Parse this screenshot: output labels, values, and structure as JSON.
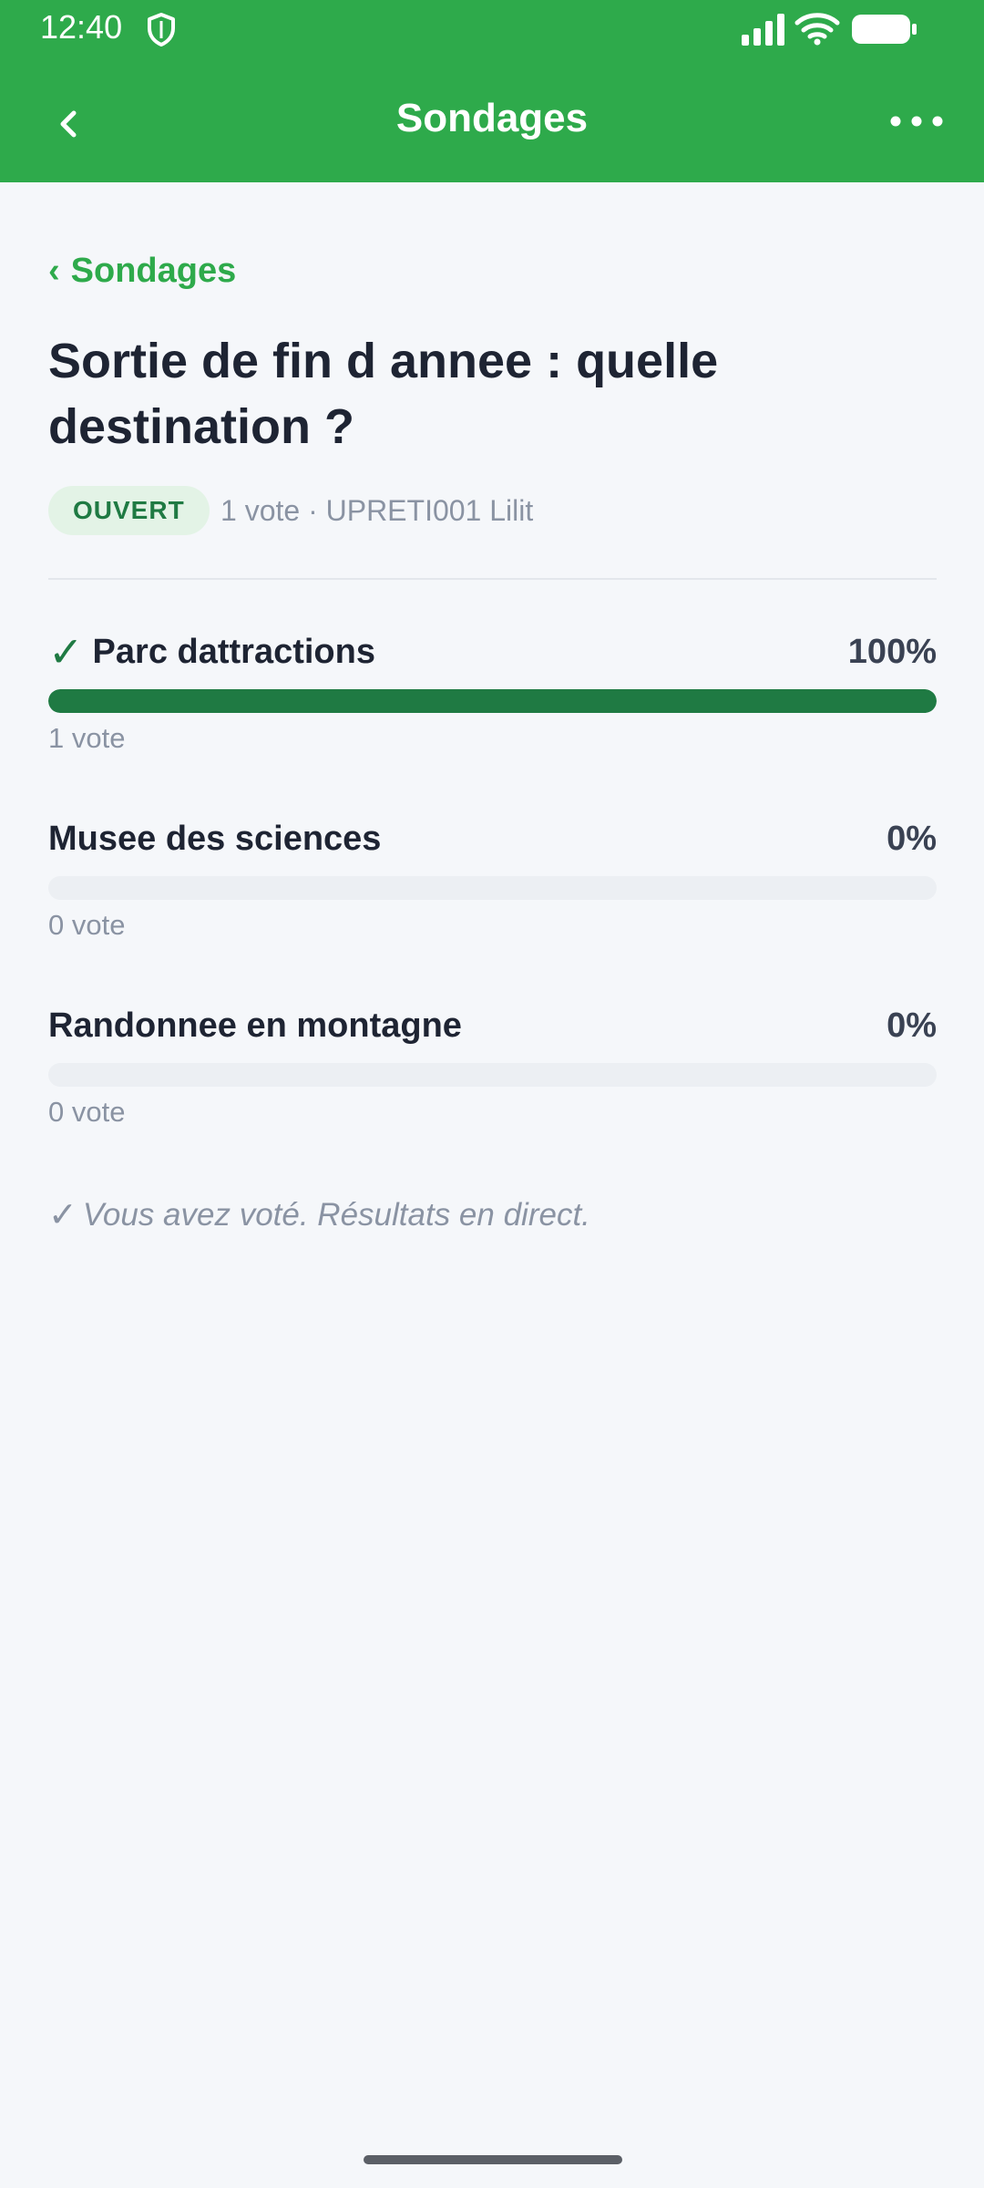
{
  "status_bar": {
    "time": "12:40",
    "icons": [
      "shield-icon",
      "signal-icon",
      "wifi-icon",
      "battery-icon"
    ]
  },
  "app_bar": {
    "title": "Sondages",
    "back_icon": "chevron-left-icon",
    "menu_icon": "more-horizontal-icon"
  },
  "breadcrumb": {
    "label": "Sondages",
    "chevron": "‹"
  },
  "poll": {
    "title": "Sortie de fin d annee : quelle destination ?",
    "status": "OUVERT",
    "meta": "1 vote · UPRETI001 Lilit",
    "options": [
      {
        "label": "Parc dattractions",
        "percent_label": "100%",
        "fraction": 1.0,
        "votes_label": "1 vote",
        "selected": true,
        "check": "✓"
      },
      {
        "label": "Musee des sciences",
        "percent_label": "0%",
        "fraction": 0.0,
        "votes_label": "0 vote",
        "selected": false
      },
      {
        "label": "Randonnee en montagne",
        "percent_label": "0%",
        "fraction": 0.0,
        "votes_label": "0 vote",
        "selected": false
      }
    ],
    "note": "Vous avez voté. Résultats en direct.",
    "note_check": "✓"
  },
  "colors": {
    "header": "#2eaa4b",
    "accent": "#2eaa4b",
    "progress_fill": "#1f7a43",
    "progress_track": "#eceff3",
    "badge_bg": "#e3f3e6",
    "badge_text": "#1f7a43",
    "background": "#f5f7fa"
  }
}
